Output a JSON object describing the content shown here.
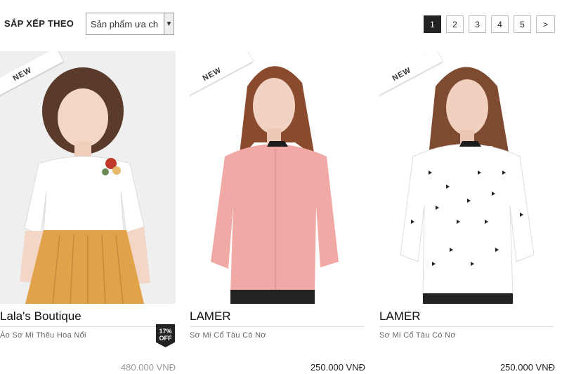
{
  "toolbar": {
    "sort_label": "SẮP XẾP THEO",
    "sort_value": "Sản phẩm ưa ch",
    "pages": [
      "1",
      "2",
      "3",
      "4",
      "5"
    ],
    "active_page": "1",
    "next_label": ">"
  },
  "products": [
    {
      "ribbon": "NEW",
      "brand": "Lala's Boutique",
      "title": "Áo Sơ Mi Thêu Hoa Nổi",
      "badge_top": "17%",
      "badge_bottom": "OFF",
      "price": "480.000 VNĐ"
    },
    {
      "ribbon": "NEW",
      "brand": "LAMER",
      "title": "Sơ Mi Cổ Tàu Có Nơ",
      "price": "250.000 VNĐ"
    },
    {
      "ribbon": "NEW",
      "brand": "LAMER",
      "title": "Sơ Mi Cổ Tàu Có Nơ",
      "price": "250.000 VNĐ"
    }
  ],
  "colors": {
    "accent": "#222222",
    "muted_price": "#999999",
    "blouse_pink": "#f1a9a6",
    "skirt": "#e1a24a"
  }
}
